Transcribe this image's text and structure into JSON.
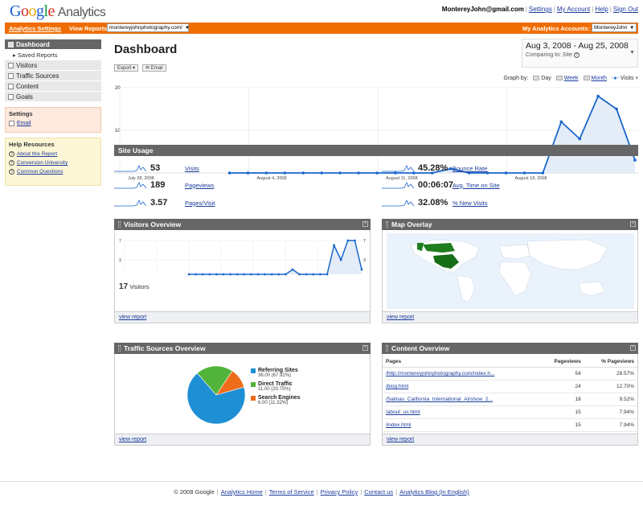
{
  "header": {
    "logo_letters": [
      "G",
      "o",
      "o",
      "g",
      "l",
      "e"
    ],
    "logo_suffix": "Analytics",
    "user_email": "MontereyJohn@gmail.com",
    "links": [
      "Settings",
      "My Account",
      "Help",
      "Sign Out"
    ]
  },
  "nav": {
    "settings_link": "Analytics Settings",
    "view_reports_label": "View Reports:",
    "profile_select": "montereyjohnphotography.com/",
    "my_accounts_label": "My Analytics Accounts:",
    "account_select": "MontereyJohn"
  },
  "sidebar": {
    "dashboard": "Dashboard",
    "saved_reports": "Saved Reports",
    "items": [
      "Visitors",
      "Traffic Sources",
      "Content",
      "Goals"
    ],
    "settings_title": "Settings",
    "settings_email": "Email",
    "help_title": "Help Resources",
    "help_links": [
      "About this Report",
      "Conversion University",
      "Common Questions"
    ]
  },
  "main": {
    "title": "Dashboard",
    "date_range": "Aug 3, 2008 - Aug 25, 2008",
    "comparing_label": "Comparing to:",
    "comparing_value": "Site",
    "export_label": "Export",
    "email_label": "Email",
    "graph_by_label": "Graph by:",
    "graph_by_options": [
      "Day",
      "Week",
      "Month"
    ],
    "graph_metric": "Visits"
  },
  "chart_data": [
    {
      "type": "line",
      "name": "main-visits",
      "x": [
        "Jul 28",
        "Jul 29",
        "Jul 30",
        "Jul 31",
        "Aug 1",
        "Aug 2",
        "Aug 3",
        "Aug 4",
        "Aug 5",
        "Aug 6",
        "Aug 7",
        "Aug 8",
        "Aug 9",
        "Aug 10",
        "Aug 11",
        "Aug 12",
        "Aug 13",
        "Aug 14",
        "Aug 15",
        "Aug 16",
        "Aug 17",
        "Aug 18",
        "Aug 19",
        "Aug 20",
        "Aug 21",
        "Aug 22",
        "Aug 23",
        "Aug 24",
        "Aug 25"
      ],
      "values": [
        null,
        null,
        null,
        null,
        null,
        null,
        0,
        0,
        0,
        0,
        0,
        0,
        0,
        0,
        0,
        0,
        0,
        0,
        1,
        0,
        0,
        0,
        0,
        0,
        12,
        8,
        18,
        15,
        3
      ],
      "ylim": [
        0,
        20
      ],
      "yticks": [
        10,
        20
      ],
      "xtick_labels": [
        "July 28, 2008",
        "August 4, 2008",
        "August 11, 2008",
        "August 18, 2008"
      ],
      "metric": "Visits"
    },
    {
      "type": "line",
      "name": "visitors-overview",
      "values": [
        0,
        0,
        0,
        0,
        0,
        0,
        0,
        0,
        0,
        0,
        0,
        0,
        0,
        0,
        0,
        1,
        0,
        0,
        0,
        0,
        0,
        6,
        3,
        7,
        7,
        1
      ],
      "ylim": [
        0,
        7
      ],
      "yticks": [
        3,
        7
      ]
    },
    {
      "type": "pie",
      "name": "traffic-sources",
      "labels": [
        "Referring Sites",
        "Direct Traffic",
        "Search Engines"
      ],
      "values": [
        36,
        11,
        6
      ],
      "display_values": [
        "36.00 (67.92%)",
        "11.00 (20.75%)",
        "6.00 (11.32%)"
      ],
      "colors": [
        "#1f8fd4",
        "#52b33a",
        "#ef6d1a"
      ]
    }
  ],
  "site_usage": {
    "title": "Site Usage",
    "rows": [
      {
        "value": "53",
        "label": "Visits"
      },
      {
        "value": "189",
        "label": "Pageviews"
      },
      {
        "value": "3.57",
        "label": "Pages/Visit"
      },
      {
        "value": "45.28%",
        "label": "Bounce Rate"
      },
      {
        "value": "00:06:07",
        "label": "Avg. Time on Site"
      },
      {
        "value": "32.08%",
        "label": "% New Visits"
      }
    ]
  },
  "visitors_overview": {
    "title": "Visitors Overview",
    "count": "17",
    "count_label": "Visitors",
    "view_report": "view report"
  },
  "map_overlay": {
    "title": "Map Overlay",
    "view_report": "view report"
  },
  "traffic_sources": {
    "title": "Traffic Sources Overview",
    "view_report": "view report"
  },
  "content_overview": {
    "title": "Content Overview",
    "headers": [
      "Pages",
      "Pageviews",
      "% Pageviews"
    ],
    "rows": [
      [
        "/http://montereyjohnphotography.com/index.h...",
        "54",
        "28.57%"
      ],
      [
        "/blog.html",
        "24",
        "12.70%"
      ],
      [
        "/Salinas_California_International_Airshow_2...",
        "18",
        "9.52%"
      ],
      [
        "/about_us.html",
        "15",
        "7.94%"
      ],
      [
        "/index.html",
        "15",
        "7.94%"
      ]
    ],
    "view_report": "view report"
  },
  "footer": {
    "copyright": "© 2008 Google",
    "links": [
      "Analytics Home",
      "Terms of Service",
      "Privacy Policy",
      "Contact us",
      "Analytics Blog (in English)"
    ]
  },
  "colors": {
    "orange": "#ef6d00",
    "line_blue": "#1a66cc",
    "area_fill": "#e3ecf7",
    "section_bar": "#666666"
  }
}
